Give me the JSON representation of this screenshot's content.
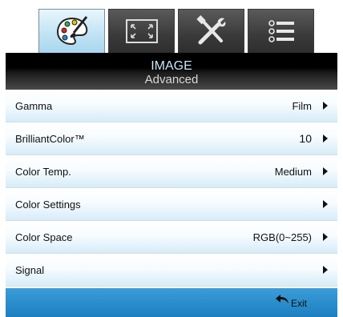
{
  "tabs": [
    {
      "icon": "palette-icon",
      "active": true
    },
    {
      "icon": "screen-corners-icon",
      "active": false
    },
    {
      "icon": "tools-icon",
      "active": false
    },
    {
      "icon": "list-icon",
      "active": false
    }
  ],
  "header": {
    "title": "IMAGE",
    "subtitle": "Advanced"
  },
  "menu": {
    "items": [
      {
        "label": "Gamma",
        "value": "Film"
      },
      {
        "label": "BrilliantColor™",
        "value": "10"
      },
      {
        "label": "Color Temp.",
        "value": "Medium"
      },
      {
        "label": "Color Settings",
        "value": ""
      },
      {
        "label": "Color Space",
        "value": "RGB(0~255)"
      },
      {
        "label": "Signal",
        "value": ""
      }
    ]
  },
  "footer": {
    "exit_label": "Exit",
    "exit_icon": "back-arrow-icon"
  },
  "colors": {
    "accent": "#2a8fd0",
    "active_tab": "#bfe2f4",
    "header": "#000000"
  }
}
